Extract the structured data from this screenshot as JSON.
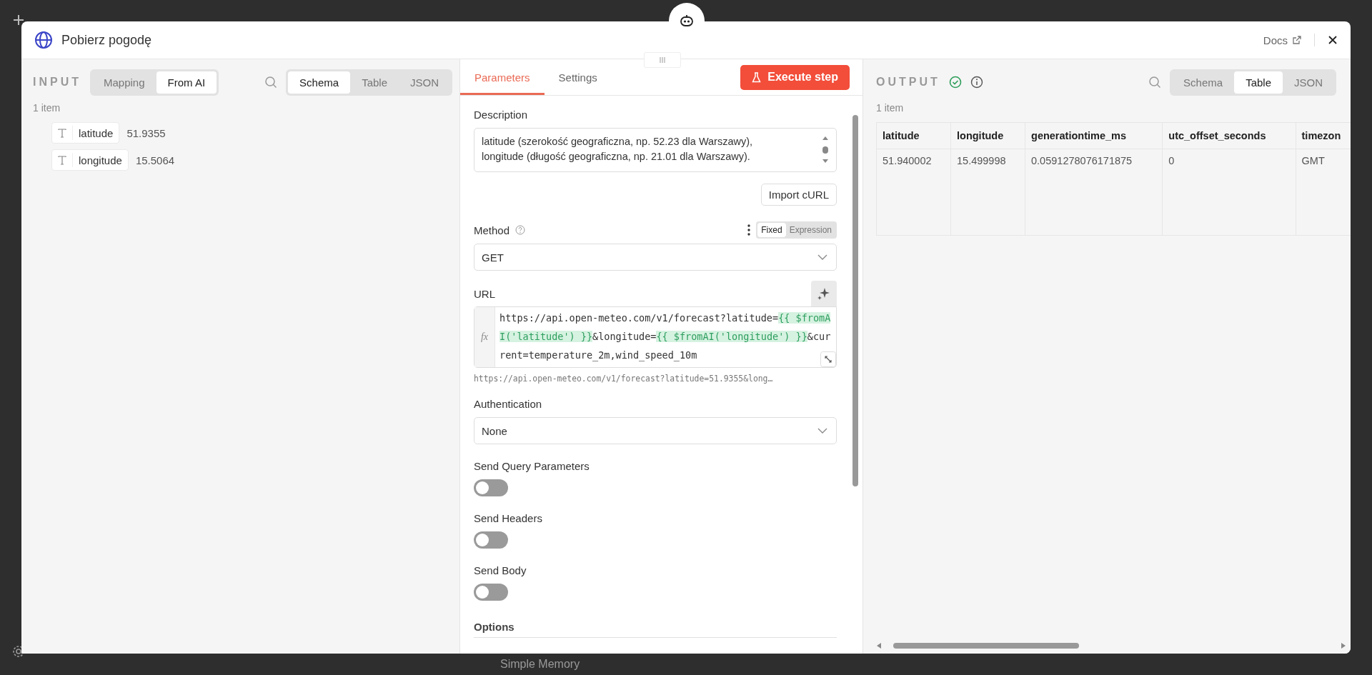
{
  "background": {
    "node_label": "Simple Memory"
  },
  "modal": {
    "title": "Pobierz pogodę",
    "docs_link": "Docs"
  },
  "input_panel": {
    "label": "INPUT",
    "mode_tabs": [
      {
        "label": "Mapping",
        "selected": false
      },
      {
        "label": "From AI",
        "selected": true
      }
    ],
    "view_tabs": [
      {
        "label": "Schema",
        "selected": true
      },
      {
        "label": "Table",
        "selected": false
      },
      {
        "label": "JSON",
        "selected": false
      }
    ],
    "item_count": "1 item",
    "fields": [
      {
        "name": "latitude",
        "value": "51.9355"
      },
      {
        "name": "longitude",
        "value": "15.5064"
      }
    ]
  },
  "parameters_panel": {
    "tabs": [
      {
        "label": "Parameters",
        "selected": true
      },
      {
        "label": "Settings",
        "selected": false
      }
    ],
    "execute_button": "Execute step",
    "description": {
      "label": "Description",
      "lines": [
        "latitude (szerokość geograficzna, np. 52.23 dla Warszawy),",
        "longitude (długość geograficzna, np. 21.01 dla Warszawy)."
      ]
    },
    "import_button": "Import cURL",
    "method": {
      "label": "Method",
      "mode_tabs": [
        {
          "label": "Fixed",
          "selected": true
        },
        {
          "label": "Expression",
          "selected": false
        }
      ],
      "value": "GET"
    },
    "url": {
      "label": "URL",
      "fx": "fx",
      "segments": [
        {
          "kind": "text",
          "text": "https://api.open-meteo.com/v1/forecast?latitude="
        },
        {
          "kind": "expression",
          "text": "{{ $fromAI('latitude') }}"
        },
        {
          "kind": "text",
          "text": "&longitude="
        },
        {
          "kind": "expression",
          "text": "{{ $fromAI('longitude') }}"
        },
        {
          "kind": "text",
          "text": "&current=temperature_2m,wind_speed_10m"
        }
      ],
      "preview": "https://api.open-meteo.com/v1/forecast?latitude=51.9355&long…"
    },
    "authentication": {
      "label": "Authentication",
      "value": "None"
    },
    "toggles": [
      {
        "label": "Send Query Parameters",
        "on": false
      },
      {
        "label": "Send Headers",
        "on": false
      },
      {
        "label": "Send Body",
        "on": false
      }
    ],
    "options_label": "Options"
  },
  "output_panel": {
    "label": "OUTPUT",
    "success": true,
    "view_tabs": [
      {
        "label": "Schema",
        "selected": false
      },
      {
        "label": "Table",
        "selected": true
      },
      {
        "label": "JSON",
        "selected": false
      }
    ],
    "item_count": "1 item",
    "table": {
      "columns": [
        "latitude",
        "longitude",
        "generationtime_ms",
        "utc_offset_seconds",
        "timezon"
      ],
      "rows": [
        [
          "51.940002",
          "15.499998",
          "0.0591278076171875",
          "0",
          "GMT"
        ]
      ]
    }
  }
}
